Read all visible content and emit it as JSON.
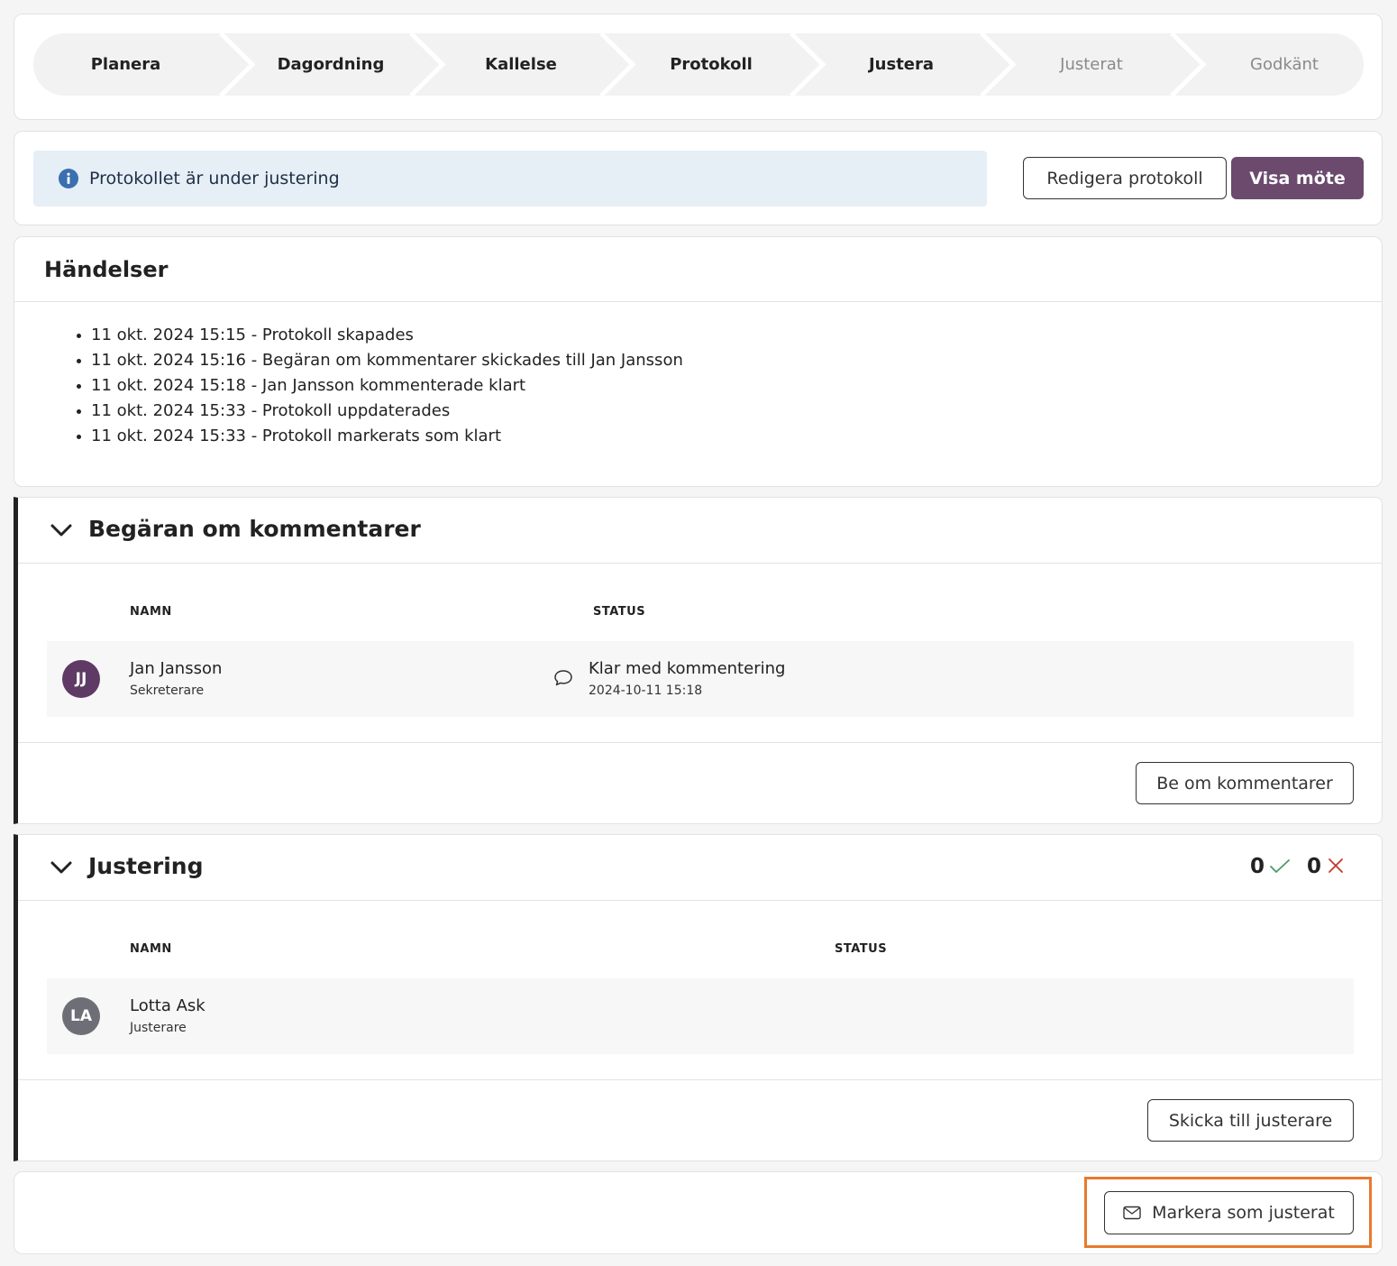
{
  "steps": [
    {
      "label": "Planera",
      "state": "done"
    },
    {
      "label": "Dagordning",
      "state": "done"
    },
    {
      "label": "Kallelse",
      "state": "done"
    },
    {
      "label": "Protokoll",
      "state": "done"
    },
    {
      "label": "Justera",
      "state": "current"
    },
    {
      "label": "Justerat",
      "state": "upcoming"
    },
    {
      "label": "Godkänt",
      "state": "upcoming"
    }
  ],
  "status": {
    "banner_text": "Protokollet är under justering",
    "edit_button": "Redigera protokoll",
    "view_button": "Visa möte"
  },
  "events": {
    "title": "Händelser",
    "items": [
      "11 okt. 2024 15:15 - Protokoll skapades",
      "11 okt. 2024 15:16 - Begäran om kommentarer skickades till Jan Jansson",
      "11 okt. 2024 15:18 - Jan Jansson kommenterade klart",
      "11 okt. 2024 15:33 - Protokoll uppdaterades",
      "11 okt. 2024 15:33 - Protokoll markerats som klart"
    ]
  },
  "comments": {
    "title": "Begäran om kommentarer",
    "col_name": "NAMN",
    "col_status": "STATUS",
    "rows": [
      {
        "initials": "JJ",
        "name": "Jan Jansson",
        "role": "Sekreterare",
        "status": "Klar med kommentering",
        "date": "2024-10-11 15:18",
        "avatar_color": "#5e3a64"
      }
    ],
    "action": "Be om kommentarer"
  },
  "adjust": {
    "title": "Justering",
    "approved_count": "0",
    "rejected_count": "0",
    "col_name": "NAMN",
    "col_status": "STATUS",
    "rows": [
      {
        "initials": "LA",
        "name": "Lotta Ask",
        "role": "Justerare",
        "avatar_color": "#6e6e76"
      }
    ],
    "action": "Skicka till justerare"
  },
  "footer": {
    "mark_button": "Markera som justerat",
    "mark_icon": "envelope-icon"
  },
  "colors": {
    "primary": "#6b4a6e",
    "approved": "#4a9a6a",
    "rejected": "#c0392b",
    "highlight": "#e87a2e"
  }
}
